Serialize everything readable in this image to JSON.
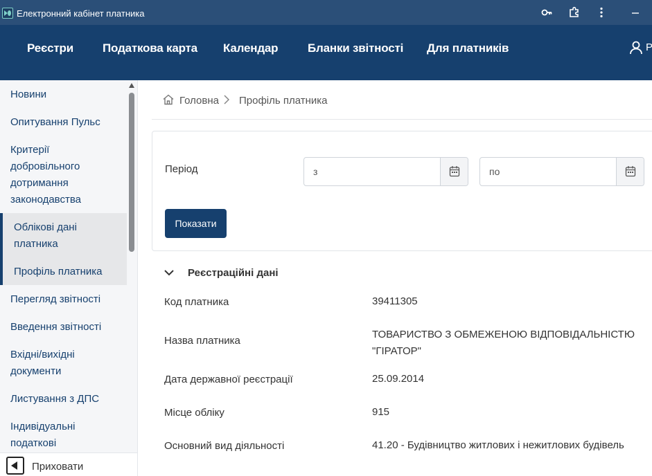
{
  "window": {
    "title": "Електронний кабінет платника",
    "icons": [
      "key-icon",
      "extension-icon",
      "more-vert-icon",
      "minimize-icon"
    ]
  },
  "nav": {
    "items": [
      "Реєстри",
      "Податкова карта",
      "Календар",
      "Бланки звітності",
      "Для платників"
    ],
    "user_label": "Р"
  },
  "sidebar": {
    "items": [
      "Новини",
      "Опитування Пульс",
      "Критерії добровільного дотримання законодавства"
    ],
    "sub_items": [
      "Облікові дані платника",
      "Профіль платника"
    ],
    "items_after": [
      "Перегляд звітності",
      "Введення звітності",
      "Вхідні/вихідні документи",
      "Листування з ДПС",
      "Індивідуальні податкові"
    ],
    "hide_label": "Приховати"
  },
  "breadcrumb": {
    "home": "Головна",
    "separator": ">",
    "current": "Профіль платника"
  },
  "filter": {
    "period_label": "Період",
    "from_placeholder": "з",
    "to_placeholder": "по",
    "show_button": "Показати"
  },
  "section": {
    "title": "Реєстраційні дані",
    "rows": [
      {
        "label": "Код платника",
        "value": "39411305"
      },
      {
        "label": "Назва платника",
        "value": "ТОВАРИСТВО З ОБМЕЖЕНОЮ ВІДПОВІДАЛЬНІСТЮ \"ГІРАТОР\""
      },
      {
        "label": "Дата державної реєстрації",
        "value": "25.09.2014"
      },
      {
        "label": "Місце обліку",
        "value": "915"
      },
      {
        "label": "Основний вид діяльності",
        "value": "41.20 - Будівництво житлових і нежитлових будівель"
      }
    ]
  },
  "colors": {
    "titlebar": "#2b4f78",
    "navbar": "#16406e",
    "accent": "#16406e",
    "sidebar_bg": "#f5f6f8"
  }
}
